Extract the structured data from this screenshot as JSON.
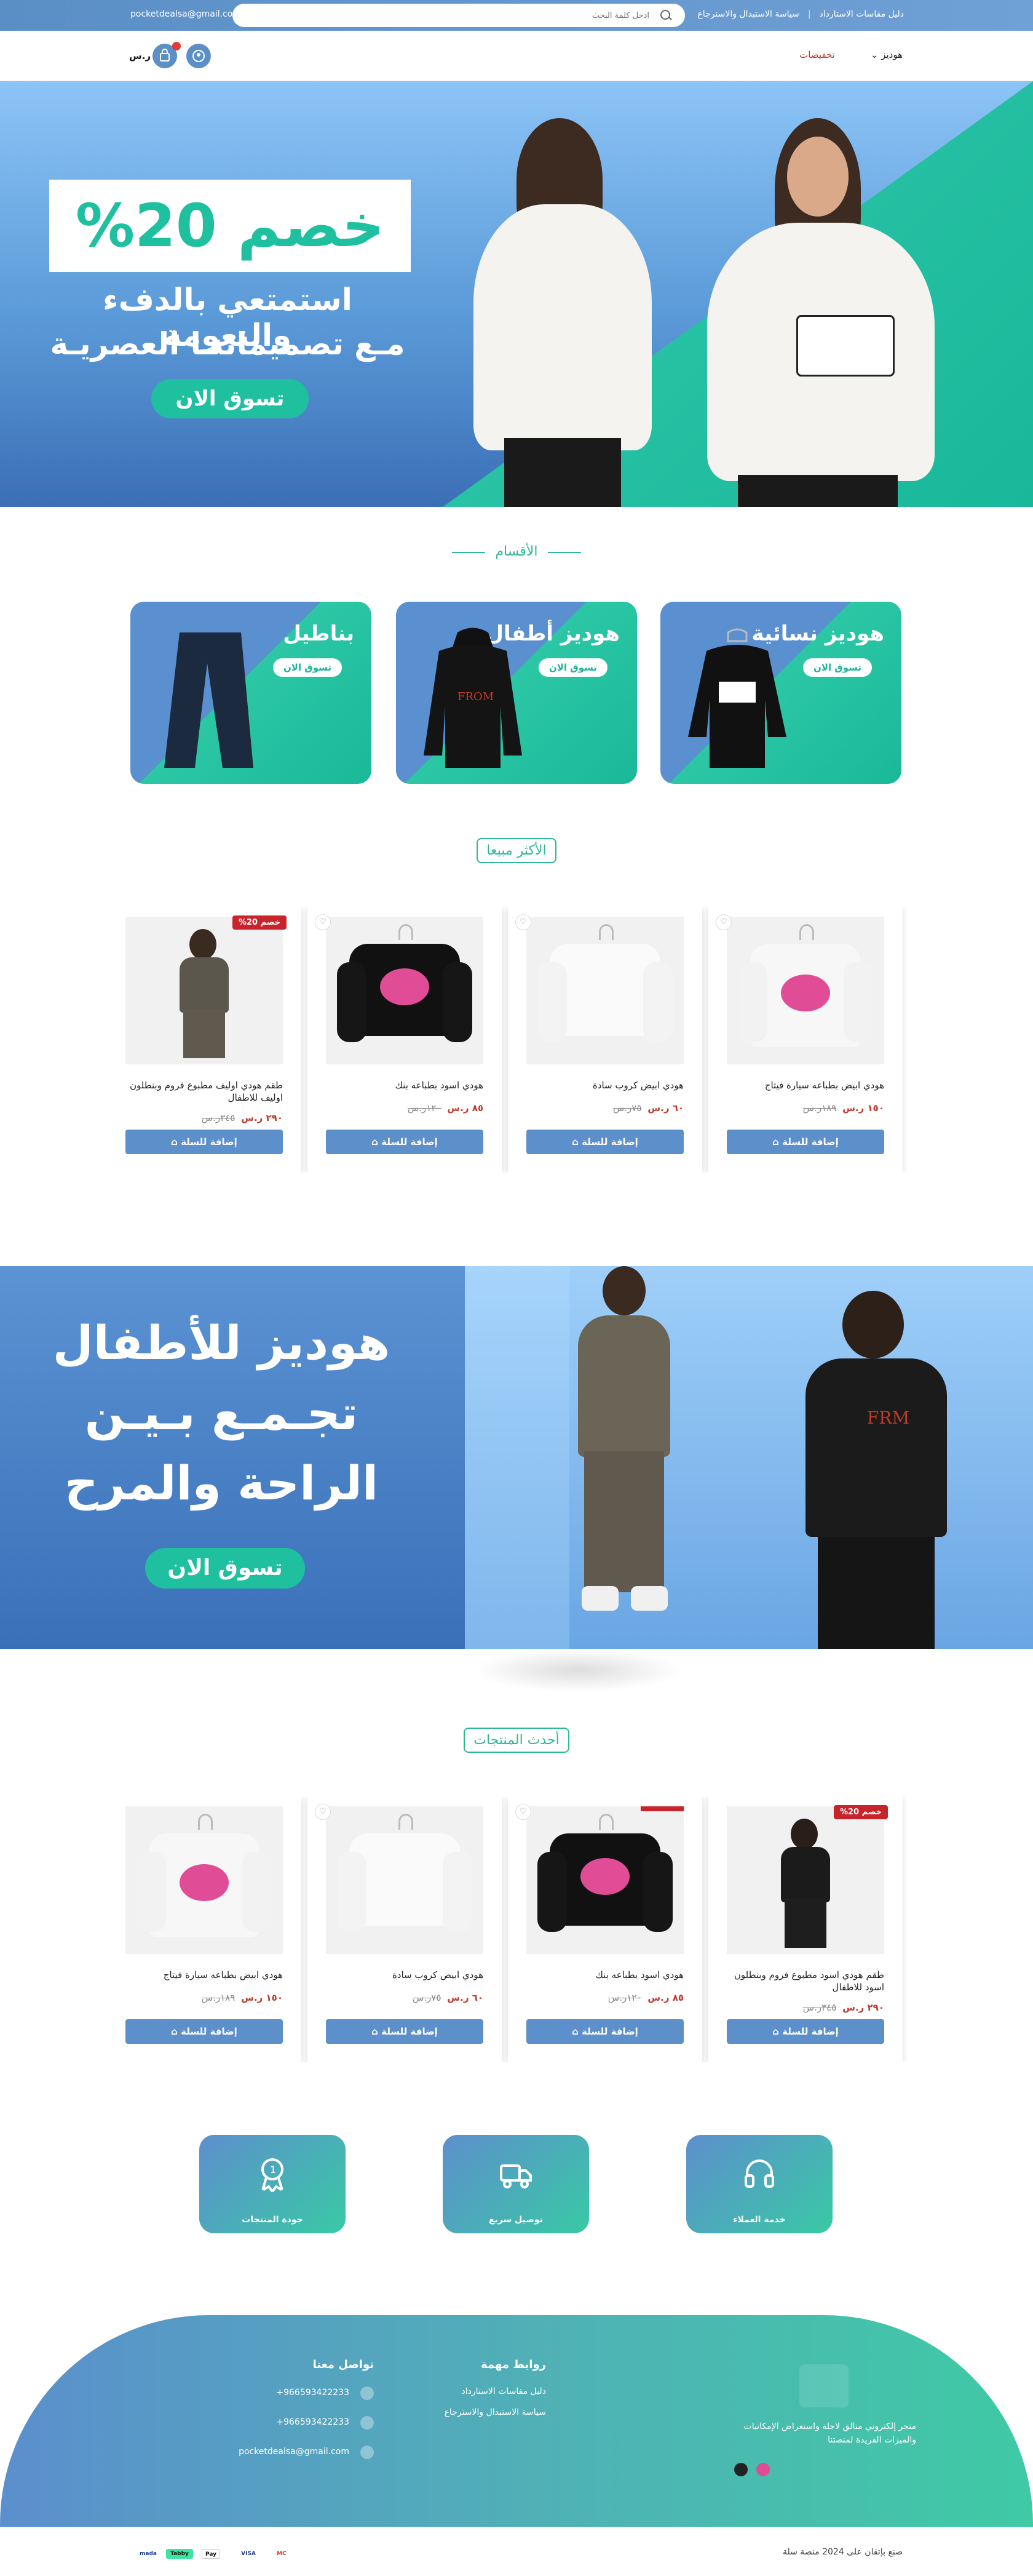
{
  "topbar": {
    "email": "pocketdealsa@gmail.com",
    "search_placeholder": "ادخل كلمة البحث",
    "links": [
      "دليل مقاسات الاستارداد",
      "سياسة الاستبدال والاسترجاع"
    ]
  },
  "nav": {
    "currency": "ر.س",
    "menu": [
      "هوديز",
      "تخفيضات"
    ]
  },
  "hero": {
    "discount": "خصم 20%",
    "line1": "استمتعي بالدفء والنعومة",
    "line2": "مـع تصميماتنـا العصريـة",
    "cta": "تسوق الان"
  },
  "categories": {
    "title": "الأقسام",
    "items": [
      {
        "name": "هوديز نسائية",
        "cta": "تسوق الان"
      },
      {
        "name": "هوديز أطفال",
        "cta": "تسوق الان"
      },
      {
        "name": "بناطيل",
        "cta": "تسوق الان"
      }
    ]
  },
  "bestsellers": {
    "title": "الأكثر مبيعا",
    "items": [
      {
        "name": "هودي ابيض بطباعه سيارة فيتاج",
        "price": "١٥٠ ر.س",
        "old": "١٨٩ر.س",
        "add": "إضافة للسلة"
      },
      {
        "name": "هودي ابيض كروب سادة",
        "price": "٦٠ ر.س",
        "old": "٧٥ر.س",
        "add": "إضافة للسلة"
      },
      {
        "name": "هودي اسود بطباعه بنك",
        "price": "٨٥ ر.س",
        "old": "١٢٠ر.س",
        "add": "إضافة للسلة"
      },
      {
        "name": "طقم هودي اوليف مطبوع فروم وبنطلون اوليف للاطفال",
        "price": "٢٩٠ ر.س",
        "old": "٣٤٥ر.س",
        "add": "إضافة للسلة",
        "discount": "خصم 20%"
      }
    ]
  },
  "kids": {
    "line1": "هوديز للأطفال",
    "line2": "تجـمـع بـيـن",
    "line3": "الراحة والمرح",
    "cta": "تسوق الان"
  },
  "latest": {
    "title": "أحدث المنتجات",
    "items": [
      {
        "name": "طقم هودي اسود مطبوع فروم وبنطلون اسود للاطفال",
        "price": "٢٩٠ ر.س",
        "old": "٣٤٥ر.س",
        "add": "إضافة للسلة",
        "discount": "خصم 20%"
      },
      {
        "name": "هودي اسود بطباعه بنك",
        "price": "٨٥ ر.س",
        "old": "١٢٠ر.س",
        "add": "إضافة للسلة"
      },
      {
        "name": "هودي ابيض كروب سادة",
        "price": "٦٠ ر.س",
        "old": "٧٥ر.س",
        "add": "إضافة للسلة"
      },
      {
        "name": "هودي ابيض بطباعه سيارة فيتاج",
        "price": "١٥٠ ر.س",
        "old": "١٨٩ر.س",
        "add": "إضافة للسلة"
      }
    ]
  },
  "features": [
    {
      "label": "خدمة العملاء",
      "icon": "headset-icon"
    },
    {
      "label": "توصيل سريع",
      "icon": "truck-icon"
    },
    {
      "label": "جودة المنتجات",
      "icon": "award-icon"
    }
  ],
  "footer": {
    "about": "متجر إلكتروني متالق لاجلة واستعراض الإمكانيات والميزات الفريدة لمنصتنا",
    "links_title": "روابط مهمة",
    "links": [
      "دليل مقاسات الاستارداد",
      "سياسة الاستبدال والاسترجاع"
    ],
    "contact_title": "تواصل معنا",
    "contacts": [
      "+966593422233",
      "+966593422233",
      "pocketdealsa@gmail.com"
    ],
    "copyright": "صنع بإتقان على 2024 منصة سلة",
    "payments": [
      "Tabby",
      "Pay",
      "VISA",
      "MC",
      "mada"
    ]
  },
  "colors": {
    "brand_blue": "#5b8fc6",
    "brand_teal": "#1ec0a0",
    "sale_red": "#c8242c"
  }
}
